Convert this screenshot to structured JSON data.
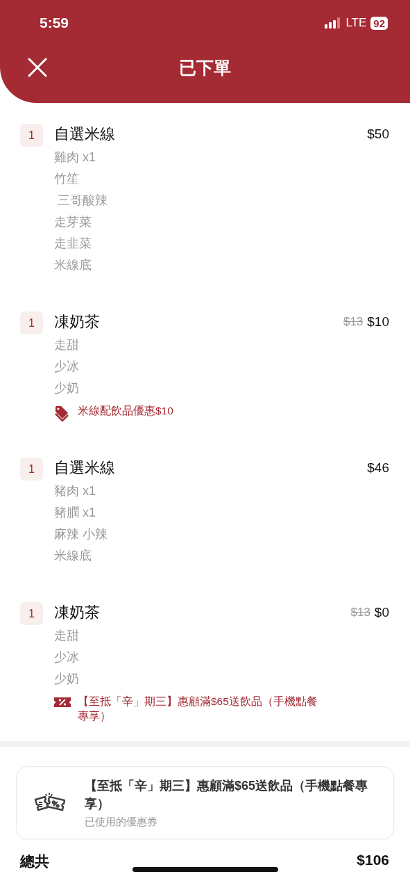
{
  "status_bar": {
    "time": "5:59",
    "network": "LTE",
    "battery": "92"
  },
  "header": {
    "title": "已下單"
  },
  "items": [
    {
      "quantity": "1",
      "name": "自選米線",
      "price": "$50",
      "options": [
        "雞肉 x1",
        "竹笙",
        " 三哥酸辣",
        "走芽菜",
        "走韭菜",
        "米線底"
      ]
    },
    {
      "quantity": "1",
      "name": "凍奶茶",
      "original_price": "$13",
      "price": "$10",
      "options": [
        "走甜",
        "少冰",
        "少奶"
      ],
      "discount": {
        "kind": "tag",
        "text": "米線配飲品優惠$10"
      }
    },
    {
      "quantity": "1",
      "name": "自選米線",
      "price": "$46",
      "options": [
        "豬肉 x1",
        "豬膶 x1",
        "麻辣 小辣",
        "米線底"
      ]
    },
    {
      "quantity": "1",
      "name": "凍奶茶",
      "original_price": "$13",
      "price": "$0",
      "options": [
        "走甜",
        "少冰",
        "少奶"
      ],
      "discount": {
        "kind": "coupon",
        "text": "【至抵「辛」期三】惠顧滿$65送飲品（手機點餐專享）"
      }
    }
  ],
  "coupon_card": {
    "title": "【至抵「辛」期三】惠顧滿$65送飲品（手機點餐專享）",
    "subtitle": "已使用的優惠券"
  },
  "total": {
    "label": "總共",
    "amount": "$106"
  }
}
